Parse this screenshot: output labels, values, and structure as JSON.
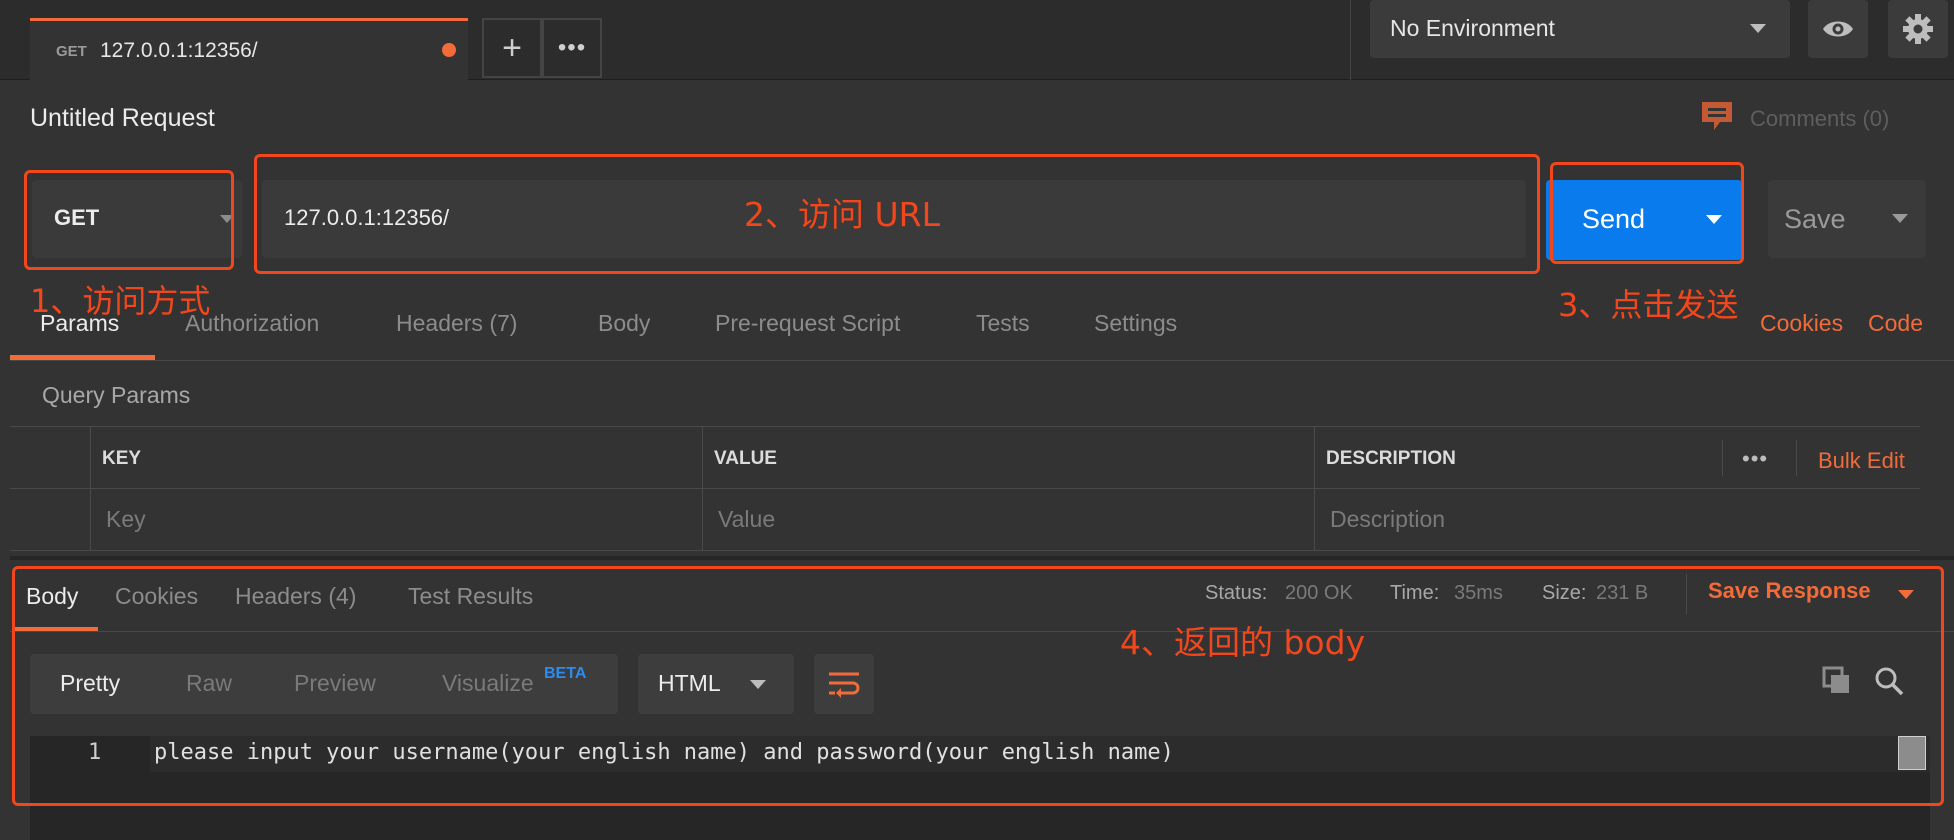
{
  "tabs": {
    "active": {
      "method": "GET",
      "url": "127.0.0.1:12356/"
    },
    "add_icon": "plus-icon",
    "more_icon": "ellipsis-icon"
  },
  "environment": {
    "selected": "No Environment"
  },
  "request": {
    "title": "Untitled Request",
    "comments_label": "Comments (0)",
    "method": "GET",
    "url": "127.0.0.1:12356/",
    "send_label": "Send",
    "save_label": "Save"
  },
  "request_tabs": [
    "Params",
    "Authorization",
    "Headers (7)",
    "Body",
    "Pre-request Script",
    "Tests",
    "Settings"
  ],
  "request_links": {
    "cookies": "Cookies",
    "code": "Code"
  },
  "query_params": {
    "title": "Query Params",
    "columns": [
      "KEY",
      "VALUE",
      "DESCRIPTION"
    ],
    "bulk_edit": "Bulk Edit",
    "placeholders": [
      "Key",
      "Value",
      "Description"
    ]
  },
  "response": {
    "tabs": [
      "Body",
      "Cookies",
      "Headers (4)",
      "Test Results"
    ],
    "status_label": "Status:",
    "status_value": "200 OK",
    "time_label": "Time:",
    "time_value": "35ms",
    "size_label": "Size:",
    "size_value": "231 B",
    "save_response": "Save Response",
    "formats": [
      "Pretty",
      "Raw",
      "Preview",
      "Visualize"
    ],
    "beta_badge": "BETA",
    "language": "HTML",
    "line_number": "1",
    "code": "please input your username(your english name) and password(your english name)"
  },
  "annotations": {
    "a1": "1、访问方式",
    "a2": "2、访问 URL",
    "a3": "3、点击发送",
    "a4": "4、返回的 body"
  },
  "colors": {
    "accent": "#f26b3a",
    "send": "#097bed",
    "annotation": "#f2471c",
    "beta": "#2d8cf0"
  }
}
